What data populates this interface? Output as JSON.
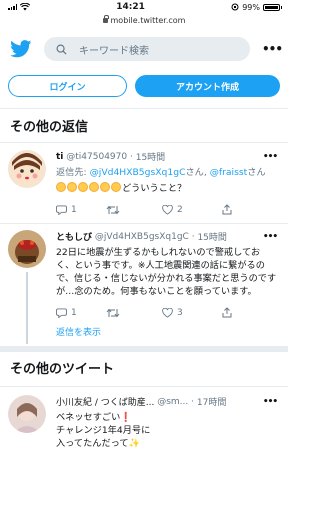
{
  "status": {
    "time": "14:21",
    "battery": "99%",
    "battery_level": 0.99
  },
  "browser": {
    "url": "mobile.twitter.com"
  },
  "search": {
    "placeholder": "キーワード検索"
  },
  "auth": {
    "login": "ログイン",
    "signup": "アカウント作成"
  },
  "replies_section": {
    "title": "その他の返信"
  },
  "tweet1": {
    "name": "ti",
    "handle": "@ti47504970",
    "sep": "·",
    "time": "15時間",
    "reply_prefix": "返信先: ",
    "reply_user1": "@jVd4HXB5gsXq1gC",
    "reply_mid": "さん, ",
    "reply_user2": "@fraisst",
    "reply_suffix": "さん",
    "text": "どういうこと？",
    "reply_count": "1",
    "retweet_count": "",
    "like_count": "2"
  },
  "tweet2": {
    "name": "ともしび",
    "handle": "@jVd4HXB5gsXq1gC",
    "sep": "·",
    "time": "15時間",
    "text": "22日に地震が生ずるかもしれないので警戒しておく、という事です。※人工地震関連の話に繋がるので、信じる・信じないが分かれる事案だと思うのですが…念のため。何事もないことを願っています。",
    "reply_count": "1",
    "retweet_count": "",
    "like_count": "3"
  },
  "show_replies": "返信を表示",
  "other_tweets": {
    "title": "その他のツイート"
  },
  "tweet3": {
    "name": "小川友紀 / つくば助産...",
    "handle": "@sm...",
    "sep": "·",
    "time": "17時間",
    "line1": "ベネッセすごい",
    "line2": "チャレンジ1年4月号に",
    "line3": "入ってたんだって"
  },
  "colors": {
    "accent": "#1da1f2",
    "muted": "#657786",
    "divider": "#e6ecf0",
    "like": "#e0245e"
  }
}
